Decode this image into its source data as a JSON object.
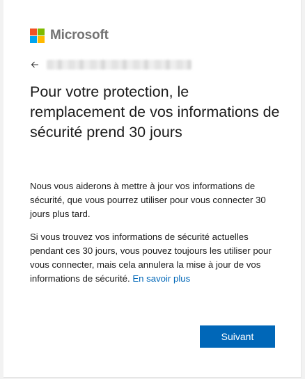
{
  "brand": {
    "name": "Microsoft",
    "logo_colors": [
      "#f25022",
      "#7fba00",
      "#00a4ef",
      "#ffb900"
    ]
  },
  "identity": {
    "back_icon": "arrow-left-icon",
    "account": ""
  },
  "main": {
    "title": "Pour votre protection, le remplacement de vos informations de sécurité prend 30 jours",
    "paragraph1": "Nous vous aiderons à mettre à jour vos informations de sécurité, que vous pourrez utiliser pour vous connecter 30 jours plus tard.",
    "paragraph2": "Si vous trouvez vos informations de sécurité actuelles pendant ces 30 jours, vous pouvez toujours les utiliser pour vous connecter, mais cela annulera la mise à jour de vos informations de sécurité.",
    "learn_more": "En savoir plus"
  },
  "actions": {
    "next_label": "Suivant"
  },
  "colors": {
    "accent": "#0067b8",
    "text": "#1b1b1b",
    "brand_text": "#737373"
  }
}
